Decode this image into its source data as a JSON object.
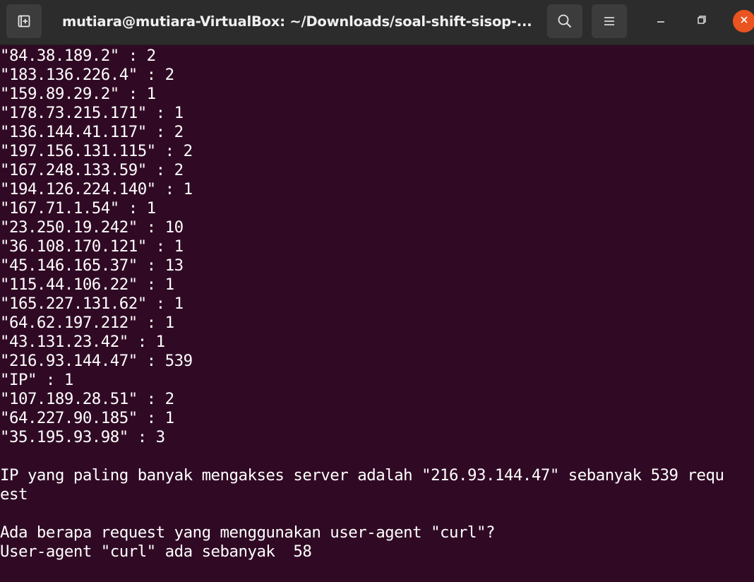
{
  "window": {
    "title": "mutiara@mutiara-VirtualBox: ~/Downloads/soal-shift-sisop-...",
    "accent_close": "#e95420",
    "background": "#300a24"
  },
  "icons": {
    "new_tab": "new-tab-icon",
    "search": "search-icon",
    "menu": "hamburger-menu-icon",
    "minimize": "minimize-icon",
    "maximize": "restore-icon",
    "close": "close-icon"
  },
  "terminal": {
    "lines": [
      "\"84.38.189.2\" : 2",
      "\"183.136.226.4\" : 2",
      "\"159.89.29.2\" : 1",
      "\"178.73.215.171\" : 1",
      "\"136.144.41.117\" : 2",
      "\"197.156.131.115\" : 2",
      "\"167.248.133.59\" : 2",
      "\"194.126.224.140\" : 1",
      "\"167.71.1.54\" : 1",
      "\"23.250.19.242\" : 10",
      "\"36.108.170.121\" : 1",
      "\"45.146.165.37\" : 13",
      "\"115.44.106.22\" : 1",
      "\"165.227.131.62\" : 1",
      "\"64.62.197.212\" : 1",
      "\"43.131.23.42\" : 1",
      "\"216.93.144.47\" : 539",
      "\"IP\" : 1",
      "\"107.189.28.51\" : 2",
      "\"64.227.90.185\" : 1",
      "\"35.195.93.98\" : 3",
      "",
      "IP yang paling banyak mengakses server adalah \"216.93.144.47\" sebanyak 539 requ",
      "est",
      "",
      "Ada berapa request yang menggunakan user-agent \"curl\"?",
      "User-agent \"curl\" ada sebanyak  58"
    ]
  }
}
